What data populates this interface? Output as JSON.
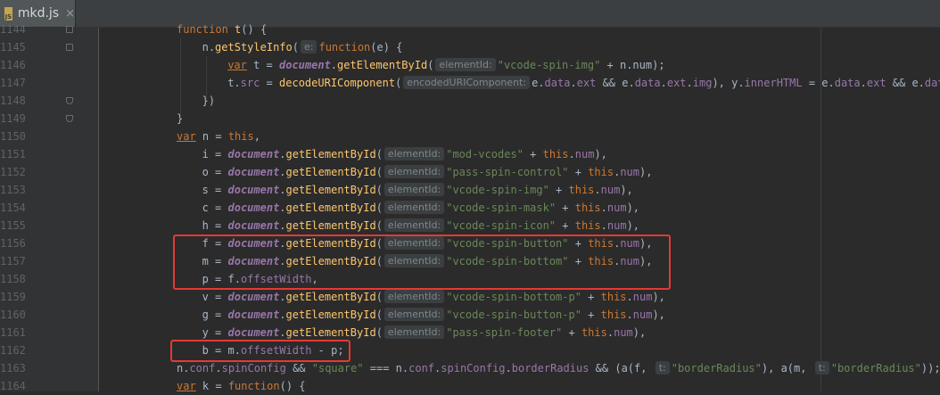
{
  "tab": {
    "file_name": "mkd.js",
    "close_glyph": "×",
    "icon_label": "JS"
  },
  "lines": [
    {
      "n": "1144",
      "indent": 0,
      "fold": "open",
      "tokens": [
        [
          "kw",
          "function "
        ],
        [
          "fn",
          "t"
        ],
        [
          "plain",
          "() {"
        ]
      ]
    },
    {
      "n": "1145",
      "indent": 1,
      "fold": "open",
      "tokens": [
        [
          "plain",
          "n."
        ],
        [
          "fn",
          "getStyleInfo"
        ],
        [
          "plain",
          "("
        ],
        [
          "hint",
          "e:"
        ],
        [
          "kw",
          "function"
        ],
        [
          "plain",
          "(e) {"
        ]
      ]
    },
    {
      "n": "1146",
      "indent": 2,
      "tokens": [
        [
          "varkw",
          "var"
        ],
        [
          "plain",
          " t = "
        ],
        [
          "doc",
          "document"
        ],
        [
          "plain",
          "."
        ],
        [
          "fn",
          "getElementById"
        ],
        [
          "plain",
          "("
        ],
        [
          "hint",
          "elementId:"
        ],
        [
          "str",
          "\"vcode-spin-img\""
        ],
        [
          "plain",
          " + n.num);"
        ]
      ]
    },
    {
      "n": "1147",
      "indent": 2,
      "tokens": [
        [
          "plain",
          "t."
        ],
        [
          "prop",
          "src"
        ],
        [
          "plain",
          " = "
        ],
        [
          "fn",
          "decodeURIComponent"
        ],
        [
          "plain",
          "("
        ],
        [
          "hint",
          "encodedURIComponent:"
        ],
        [
          "plain",
          "e."
        ],
        [
          "prop",
          "data"
        ],
        [
          "plain",
          "."
        ],
        [
          "prop",
          "ext"
        ],
        [
          "plain",
          " && e."
        ],
        [
          "prop",
          "data"
        ],
        [
          "plain",
          "."
        ],
        [
          "prop",
          "ext"
        ],
        [
          "plain",
          "."
        ],
        [
          "prop",
          "img"
        ],
        [
          "plain",
          "), y."
        ],
        [
          "prop",
          "innerHTML"
        ],
        [
          "plain",
          " = e."
        ],
        [
          "prop",
          "data"
        ],
        [
          "plain",
          "."
        ],
        [
          "prop",
          "ext"
        ],
        [
          "plain",
          " && e."
        ],
        [
          "prop",
          "data"
        ]
      ]
    },
    {
      "n": "1148",
      "indent": 1,
      "fold": "end",
      "tokens": [
        [
          "plain",
          "})"
        ]
      ]
    },
    {
      "n": "1149",
      "indent": 0,
      "fold": "end",
      "tokens": [
        [
          "plain",
          "}"
        ]
      ]
    },
    {
      "n": "1150",
      "indent": 0,
      "tokens": [
        [
          "varkw",
          "var"
        ],
        [
          "plain",
          " n = "
        ],
        [
          "kw",
          "this"
        ],
        [
          "plain",
          ","
        ]
      ]
    },
    {
      "n": "1151",
      "indent": 1,
      "tokens": [
        [
          "plain",
          "i = "
        ],
        [
          "doc",
          "document"
        ],
        [
          "plain",
          "."
        ],
        [
          "fn",
          "getElementById"
        ],
        [
          "plain",
          "("
        ],
        [
          "hint",
          "elementId:"
        ],
        [
          "str",
          "\"mod-vcodes\""
        ],
        [
          "plain",
          " + "
        ],
        [
          "kw",
          "this"
        ],
        [
          "plain",
          "."
        ],
        [
          "prop",
          "num"
        ],
        [
          "plain",
          "),"
        ]
      ]
    },
    {
      "n": "1152",
      "indent": 1,
      "tokens": [
        [
          "plain",
          "o = "
        ],
        [
          "doc",
          "document"
        ],
        [
          "plain",
          "."
        ],
        [
          "fn",
          "getElementById"
        ],
        [
          "plain",
          "("
        ],
        [
          "hint",
          "elementId:"
        ],
        [
          "str",
          "\"pass-spin-control\""
        ],
        [
          "plain",
          " + "
        ],
        [
          "kw",
          "this"
        ],
        [
          "plain",
          "."
        ],
        [
          "prop",
          "num"
        ],
        [
          "plain",
          "),"
        ]
      ]
    },
    {
      "n": "1153",
      "indent": 1,
      "tokens": [
        [
          "plain",
          "s = "
        ],
        [
          "doc",
          "document"
        ],
        [
          "plain",
          "."
        ],
        [
          "fn",
          "getElementById"
        ],
        [
          "plain",
          "("
        ],
        [
          "hint",
          "elementId:"
        ],
        [
          "str",
          "\"vcode-spin-img\""
        ],
        [
          "plain",
          " + "
        ],
        [
          "kw",
          "this"
        ],
        [
          "plain",
          "."
        ],
        [
          "prop",
          "num"
        ],
        [
          "plain",
          "),"
        ]
      ]
    },
    {
      "n": "1154",
      "indent": 1,
      "tokens": [
        [
          "plain",
          "c = "
        ],
        [
          "doc",
          "document"
        ],
        [
          "plain",
          "."
        ],
        [
          "fn",
          "getElementById"
        ],
        [
          "plain",
          "("
        ],
        [
          "hint",
          "elementId:"
        ],
        [
          "str",
          "\"vcode-spin-mask\""
        ],
        [
          "plain",
          " + "
        ],
        [
          "kw",
          "this"
        ],
        [
          "plain",
          "."
        ],
        [
          "prop",
          "num"
        ],
        [
          "plain",
          "),"
        ]
      ]
    },
    {
      "n": "1155",
      "indent": 1,
      "tokens": [
        [
          "plain",
          "h = "
        ],
        [
          "doc",
          "document"
        ],
        [
          "plain",
          "."
        ],
        [
          "fn",
          "getElementById"
        ],
        [
          "plain",
          "("
        ],
        [
          "hint",
          "elementId:"
        ],
        [
          "str",
          "\"vcode-spin-icon\""
        ],
        [
          "plain",
          " + "
        ],
        [
          "kw",
          "this"
        ],
        [
          "plain",
          "."
        ],
        [
          "prop",
          "num"
        ],
        [
          "plain",
          "),"
        ]
      ]
    },
    {
      "n": "1156",
      "indent": 1,
      "tokens": [
        [
          "plain",
          "f = "
        ],
        [
          "doc",
          "document"
        ],
        [
          "plain",
          "."
        ],
        [
          "fn",
          "getElementById"
        ],
        [
          "plain",
          "("
        ],
        [
          "hint",
          "elementId:"
        ],
        [
          "str",
          "\"vcode-spin-button\""
        ],
        [
          "plain",
          " + "
        ],
        [
          "kw",
          "this"
        ],
        [
          "plain",
          "."
        ],
        [
          "prop",
          "num"
        ],
        [
          "plain",
          "),"
        ]
      ]
    },
    {
      "n": "1157",
      "indent": 1,
      "tokens": [
        [
          "plain",
          "m = "
        ],
        [
          "doc",
          "document"
        ],
        [
          "plain",
          "."
        ],
        [
          "fn",
          "getElementById"
        ],
        [
          "plain",
          "("
        ],
        [
          "hint",
          "elementId:"
        ],
        [
          "str",
          "\"vcode-spin-bottom\""
        ],
        [
          "plain",
          " + "
        ],
        [
          "kw",
          "this"
        ],
        [
          "plain",
          "."
        ],
        [
          "prop",
          "num"
        ],
        [
          "plain",
          "),"
        ]
      ]
    },
    {
      "n": "1158",
      "indent": 1,
      "tokens": [
        [
          "plain",
          "p = f."
        ],
        [
          "prop",
          "offsetWidth"
        ],
        [
          "plain",
          ","
        ]
      ]
    },
    {
      "n": "1159",
      "indent": 1,
      "tokens": [
        [
          "plain",
          "v = "
        ],
        [
          "doc",
          "document"
        ],
        [
          "plain",
          "."
        ],
        [
          "fn",
          "getElementById"
        ],
        [
          "plain",
          "("
        ],
        [
          "hint",
          "elementId:"
        ],
        [
          "str",
          "\"vcode-spin-bottom-p\""
        ],
        [
          "plain",
          " + "
        ],
        [
          "kw",
          "this"
        ],
        [
          "plain",
          "."
        ],
        [
          "prop",
          "num"
        ],
        [
          "plain",
          "),"
        ]
      ]
    },
    {
      "n": "1160",
      "indent": 1,
      "tokens": [
        [
          "plain",
          "g = "
        ],
        [
          "doc",
          "document"
        ],
        [
          "plain",
          "."
        ],
        [
          "fn",
          "getElementById"
        ],
        [
          "plain",
          "("
        ],
        [
          "hint",
          "elementId:"
        ],
        [
          "str",
          "\"vcode-spin-button-p\""
        ],
        [
          "plain",
          " + "
        ],
        [
          "kw",
          "this"
        ],
        [
          "plain",
          "."
        ],
        [
          "prop",
          "num"
        ],
        [
          "plain",
          "),"
        ]
      ]
    },
    {
      "n": "1161",
      "indent": 1,
      "tokens": [
        [
          "plain",
          "y = "
        ],
        [
          "doc",
          "document"
        ],
        [
          "plain",
          "."
        ],
        [
          "fn",
          "getElementById"
        ],
        [
          "plain",
          "("
        ],
        [
          "hint",
          "elementId:"
        ],
        [
          "str",
          "\"pass-spin-footer\""
        ],
        [
          "plain",
          " + "
        ],
        [
          "kw",
          "this"
        ],
        [
          "plain",
          "."
        ],
        [
          "prop",
          "num"
        ],
        [
          "plain",
          "),"
        ]
      ]
    },
    {
      "n": "1162",
      "indent": 1,
      "tokens": [
        [
          "plain",
          "b = m."
        ],
        [
          "prop",
          "offsetWidth"
        ],
        [
          "plain",
          " - p;"
        ]
      ]
    },
    {
      "n": "1163",
      "indent": 0,
      "tokens": [
        [
          "plain",
          "n."
        ],
        [
          "prop",
          "conf"
        ],
        [
          "plain",
          "."
        ],
        [
          "prop",
          "spinConfig"
        ],
        [
          "plain",
          " && "
        ],
        [
          "str",
          "\"square\""
        ],
        [
          "plain",
          " === n."
        ],
        [
          "prop",
          "conf"
        ],
        [
          "plain",
          "."
        ],
        [
          "prop",
          "spinConfig"
        ],
        [
          "plain",
          "."
        ],
        [
          "prop",
          "borderRadius"
        ],
        [
          "plain",
          " && (a(f, "
        ],
        [
          "hint",
          "t:"
        ],
        [
          "str",
          "\"borderRadius\""
        ],
        [
          "plain",
          "), a(m, "
        ],
        [
          "hint",
          "t:"
        ],
        [
          "str",
          "\"borderRadius\""
        ],
        [
          "plain",
          "));"
        ]
      ]
    },
    {
      "n": "1164",
      "indent": 0,
      "tokens": [
        [
          "varkw",
          "var"
        ],
        [
          "plain",
          " k = "
        ],
        [
          "kw",
          "function"
        ],
        [
          "plain",
          "() {"
        ]
      ]
    }
  ],
  "colors": {
    "highlight_box": "#e53935",
    "background": "#2b2b2b"
  }
}
